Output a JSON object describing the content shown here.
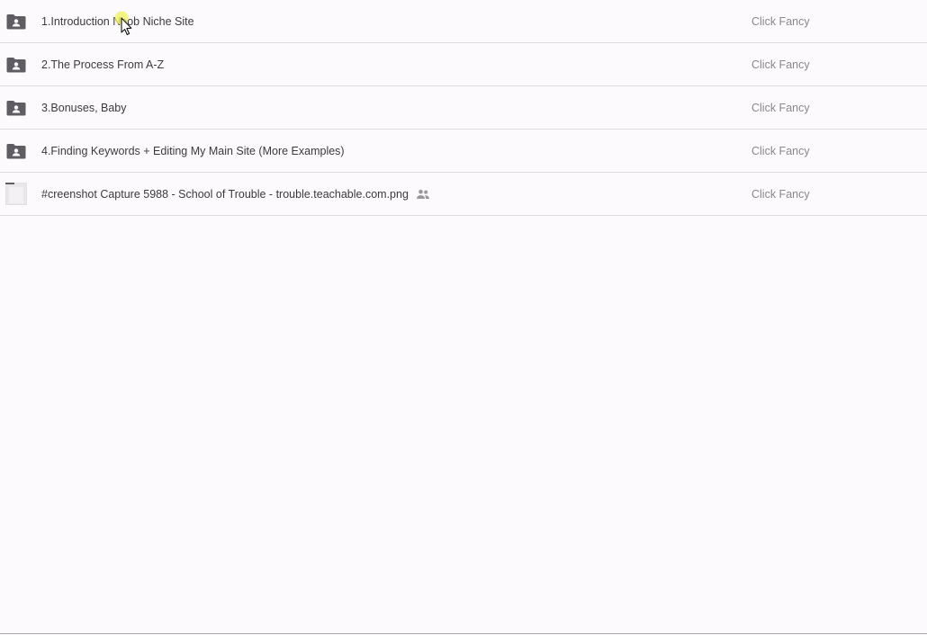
{
  "files": [
    {
      "kind": "folder",
      "icon": "shared-folder-icon",
      "name": "1.Introduction Noob Niche Site",
      "owner": "Click Fancy",
      "shared": false
    },
    {
      "kind": "folder",
      "icon": "shared-folder-icon",
      "name": "2.The Process From A-Z",
      "owner": "Click Fancy",
      "shared": false
    },
    {
      "kind": "folder",
      "icon": "shared-folder-icon",
      "name": "3.Bonuses, Baby",
      "owner": "Click Fancy",
      "shared": false
    },
    {
      "kind": "folder",
      "icon": "shared-folder-icon",
      "name": "4.Finding Keywords + Editing My Main Site (More Examples)",
      "owner": "Click Fancy",
      "shared": false
    },
    {
      "kind": "image",
      "icon": "image-thumbnail",
      "name": "#creenshot Capture 5988 - School of Trouble - trouble.teachable.com.png",
      "owner": "Click Fancy",
      "shared": true,
      "shared_icon": "people-icon"
    }
  ],
  "colors": {
    "background": "#fcfafc",
    "folder_icon": "#5f5d62",
    "name_text": "#3c3a3e",
    "owner_text": "#8a888c",
    "cursor_highlight": "#f2f25a"
  }
}
